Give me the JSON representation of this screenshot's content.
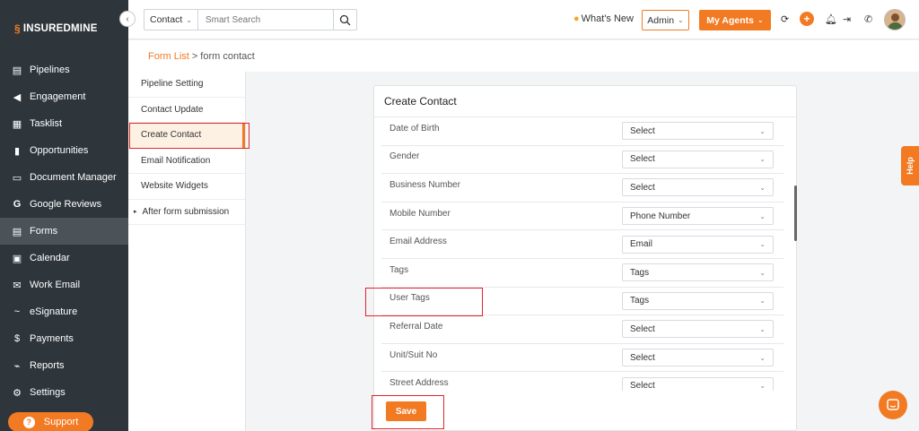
{
  "brand": {
    "name": "INSUREDMINE",
    "accent": "#f27a23"
  },
  "sidebar": {
    "items": [
      {
        "label": "Pipelines",
        "icon": "pipeline-icon"
      },
      {
        "label": "Engagement",
        "icon": "megaphone-icon"
      },
      {
        "label": "Tasklist",
        "icon": "clipboard-icon"
      },
      {
        "label": "Opportunities",
        "icon": "bar-chart-icon"
      },
      {
        "label": "Document Manager",
        "icon": "folder-icon"
      },
      {
        "label": "Google Reviews",
        "icon": "google-icon"
      },
      {
        "label": "Forms",
        "icon": "forms-icon",
        "active": true
      },
      {
        "label": "Calendar",
        "icon": "calendar-icon"
      },
      {
        "label": "Work Email",
        "icon": "mail-icon"
      },
      {
        "label": "eSignature",
        "icon": "signature-icon"
      },
      {
        "label": "Payments",
        "icon": "dollar-icon"
      },
      {
        "label": "Reports",
        "icon": "line-chart-icon"
      },
      {
        "label": "Settings",
        "icon": "gear-icon"
      }
    ],
    "support_label": "Support"
  },
  "topbar": {
    "search_type": "Contact",
    "search_placeholder": "Smart Search",
    "whats_new": "What's New",
    "admin": "Admin",
    "my_agents": "My Agents"
  },
  "breadcrumb": {
    "link": "Form List",
    "separator": ">",
    "current": "form contact"
  },
  "submenu": {
    "items": [
      "Pipeline Setting",
      "Contact Update",
      "Create Contact",
      "Email Notification",
      "Website Widgets",
      "After form submission"
    ]
  },
  "card": {
    "title": "Create Contact",
    "fields": [
      {
        "label": "Date of Birth",
        "value": "Select"
      },
      {
        "label": "Gender",
        "value": "Select"
      },
      {
        "label": "Business Number",
        "value": "Select"
      },
      {
        "label": "Mobile Number",
        "value": "Phone Number"
      },
      {
        "label": "Email Address",
        "value": "Email"
      },
      {
        "label": "Tags",
        "value": "Tags"
      },
      {
        "label": "User Tags",
        "value": "Tags"
      },
      {
        "label": "Referral Date",
        "value": "Select"
      },
      {
        "label": "Unit/Suit No",
        "value": "Select"
      },
      {
        "label": "Street Address",
        "value": "Select"
      }
    ],
    "save_label": "Save"
  },
  "help_label": "Help"
}
